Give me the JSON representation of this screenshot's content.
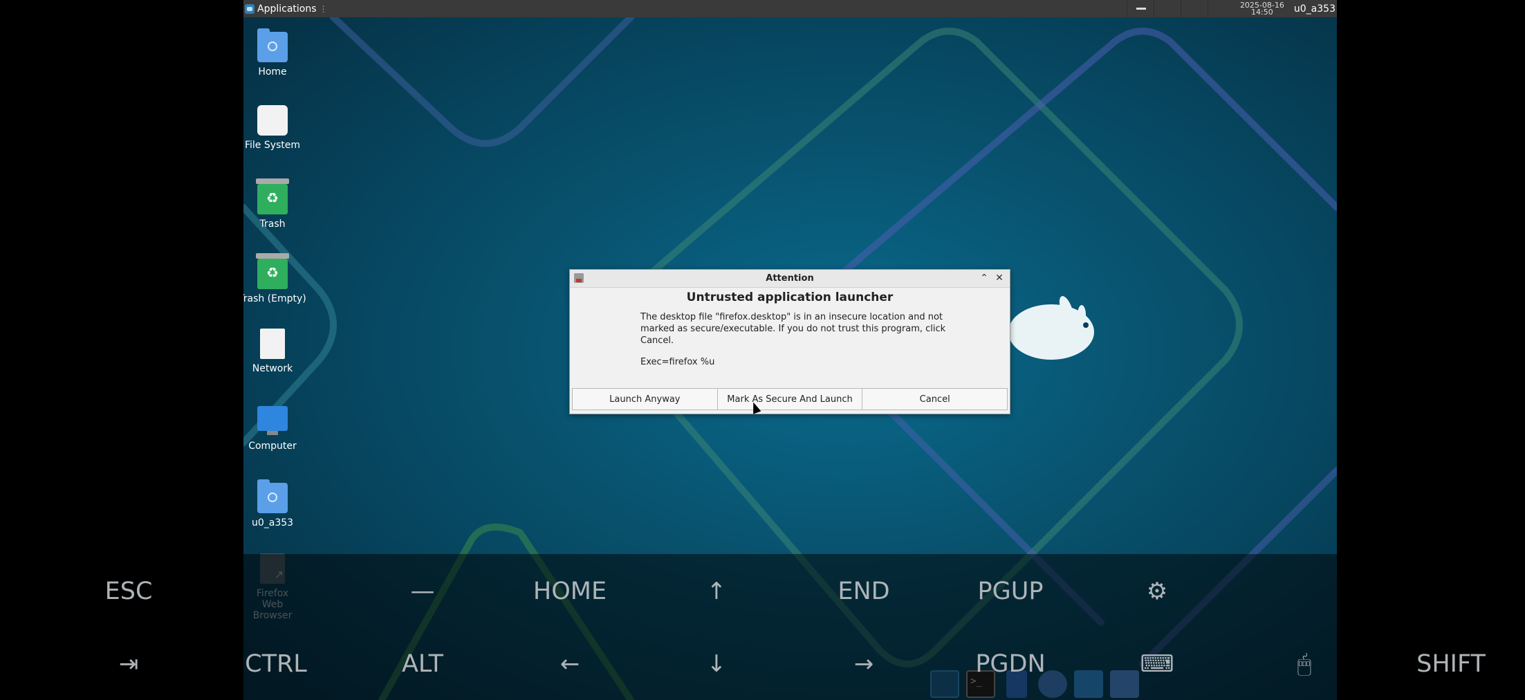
{
  "top_panel": {
    "applications_label": "Applications",
    "clock_date": "2025-08-16",
    "clock_time": "14:50",
    "username": "u0_a353"
  },
  "desktop_icons": [
    {
      "label": "Home",
      "icon": "home-folder-icon"
    },
    {
      "label": "File System",
      "icon": "drive-icon"
    },
    {
      "label": "Trash",
      "icon": "trash-icon"
    },
    {
      "label": "Trash (Empty)",
      "icon": "trash-empty-icon"
    },
    {
      "label": "Network",
      "icon": "network-icon"
    },
    {
      "label": "Computer",
      "icon": "computer-icon"
    },
    {
      "label": "u0_a353",
      "icon": "user-folder-icon"
    },
    {
      "label": "Firefox Web Browser",
      "icon": "firefox-launcher-icon"
    }
  ],
  "dialog": {
    "title": "Attention",
    "heading": "Untrusted application launcher",
    "message": "The desktop file \"firefox.desktop\" is in an insecure location and not marked as secure/executable. If you do not trust this program, click Cancel.",
    "exec": "Exec=firefox %u",
    "buttons": {
      "launch_anyway": "Launch Anyway",
      "mark_secure": "Mark As Secure And Launch",
      "cancel": "Cancel"
    }
  },
  "keyboard_row1": {
    "esc": "ESC",
    "dash": "—",
    "home": "HOME",
    "up": "↑",
    "end": "END",
    "pgup": "PGUP",
    "settings": "⚙"
  },
  "keyboard_row2": {
    "tab": "⇥",
    "ctrl": "CTRL",
    "alt": "ALT",
    "left": "←",
    "down": "↓",
    "right": "→",
    "pgdn": "PGDN",
    "keyboard": "⌨",
    "mouse": "🖱",
    "shift": "SHIFT"
  },
  "colors": {
    "desktop_bg": "#063f5a",
    "panel_bg": "#3a3a3a",
    "dialog_bg": "#f1f1f1",
    "key_text": "#aeb4b8"
  }
}
